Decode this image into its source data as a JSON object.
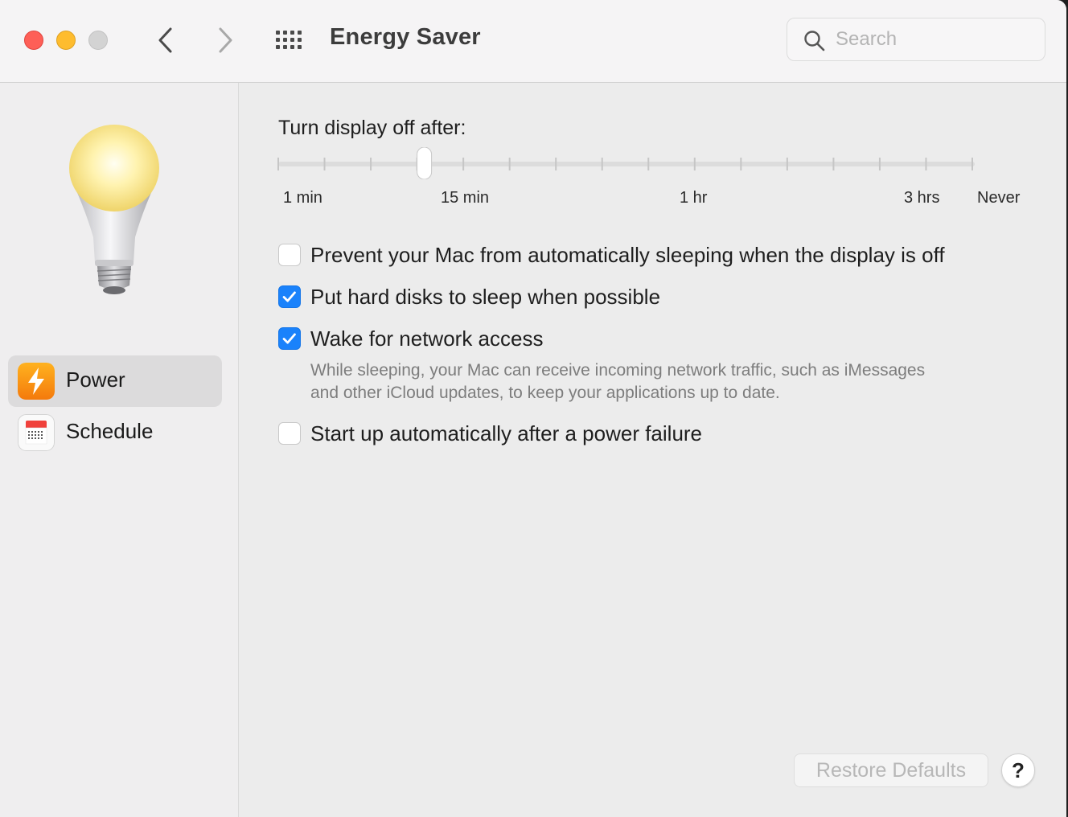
{
  "window": {
    "title": "Energy Saver",
    "traffic_lights": {
      "close_color": "#fe5f57",
      "minimize_color": "#febc2e",
      "zoom_color": "#d3d3d3"
    }
  },
  "toolbar": {
    "back_icon": "chevron-left-icon",
    "forward_icon": "chevron-right-icon",
    "grid_icon": "show-all-grid-icon"
  },
  "search": {
    "placeholder": "Search",
    "value": ""
  },
  "sidebar": {
    "items": [
      {
        "label": "Power",
        "icon": "lightning-bolt-icon",
        "selected": true
      },
      {
        "label": "Schedule",
        "icon": "calendar-icon",
        "selected": false
      }
    ]
  },
  "display_sleep": {
    "label": "Turn display off after:",
    "tick_labels": [
      "1 min",
      "15 min",
      "1 hr",
      "3 hrs",
      "Never"
    ],
    "tick_count": 16,
    "selected_tick_index": 3
  },
  "options": [
    {
      "label": "Prevent your Mac from automatically sleeping when the display is off",
      "checked": false
    },
    {
      "label": "Put hard disks to sleep when possible",
      "checked": true
    },
    {
      "label": "Wake for network access",
      "checked": true
    },
    {
      "label": "Start up automatically after a power failure",
      "checked": false
    }
  ],
  "wake_hint": {
    "line1": "While sleeping, your Mac can receive incoming network traffic, such as iMessages",
    "line2": "and other iCloud updates, to keep your applications up to date."
  },
  "footer": {
    "restore_label": "Restore Defaults",
    "help_label": "?"
  },
  "colors": {
    "accent": "#1a82fb",
    "power_icon": "#fb9a12",
    "calendar_red": "#f0413b"
  }
}
